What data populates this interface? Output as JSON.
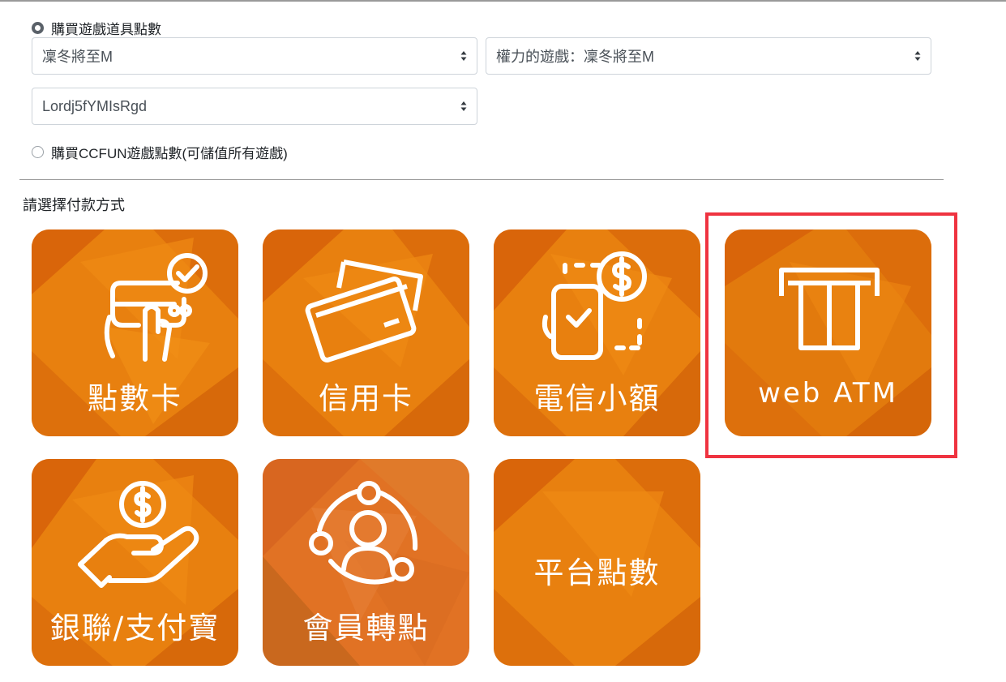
{
  "purchase_options": {
    "game_items": {
      "label": "購買遊戲道具點數",
      "selected": true
    },
    "ccfun": {
      "label": "購買CCFUN遊戲點數(可儲值所有遊戲)",
      "selected": false
    }
  },
  "selects": {
    "server": "凜冬將至M",
    "game": "權力的遊戲：凜冬將至M",
    "character": "Lordj5fYMIsRgd"
  },
  "payment": {
    "heading": "請選擇付款方式",
    "methods": [
      {
        "label": "點數卡",
        "icon": "credit-card-touch-icon"
      },
      {
        "label": "信用卡",
        "icon": "credit-cards-icon"
      },
      {
        "label": "電信小額",
        "icon": "phone-pay-icon"
      },
      {
        "label": "web ATM",
        "icon": "atm-icon",
        "highlighted": true
      },
      {
        "label": "銀聯/支付寶",
        "icon": "hand-coin-icon"
      },
      {
        "label": "會員轉點",
        "icon": "member-transfer-icon"
      },
      {
        "label": "平台點數",
        "icon": ""
      }
    ]
  },
  "colors": {
    "tile_orange": "#e97d0f",
    "highlight_red": "#ef3340"
  }
}
